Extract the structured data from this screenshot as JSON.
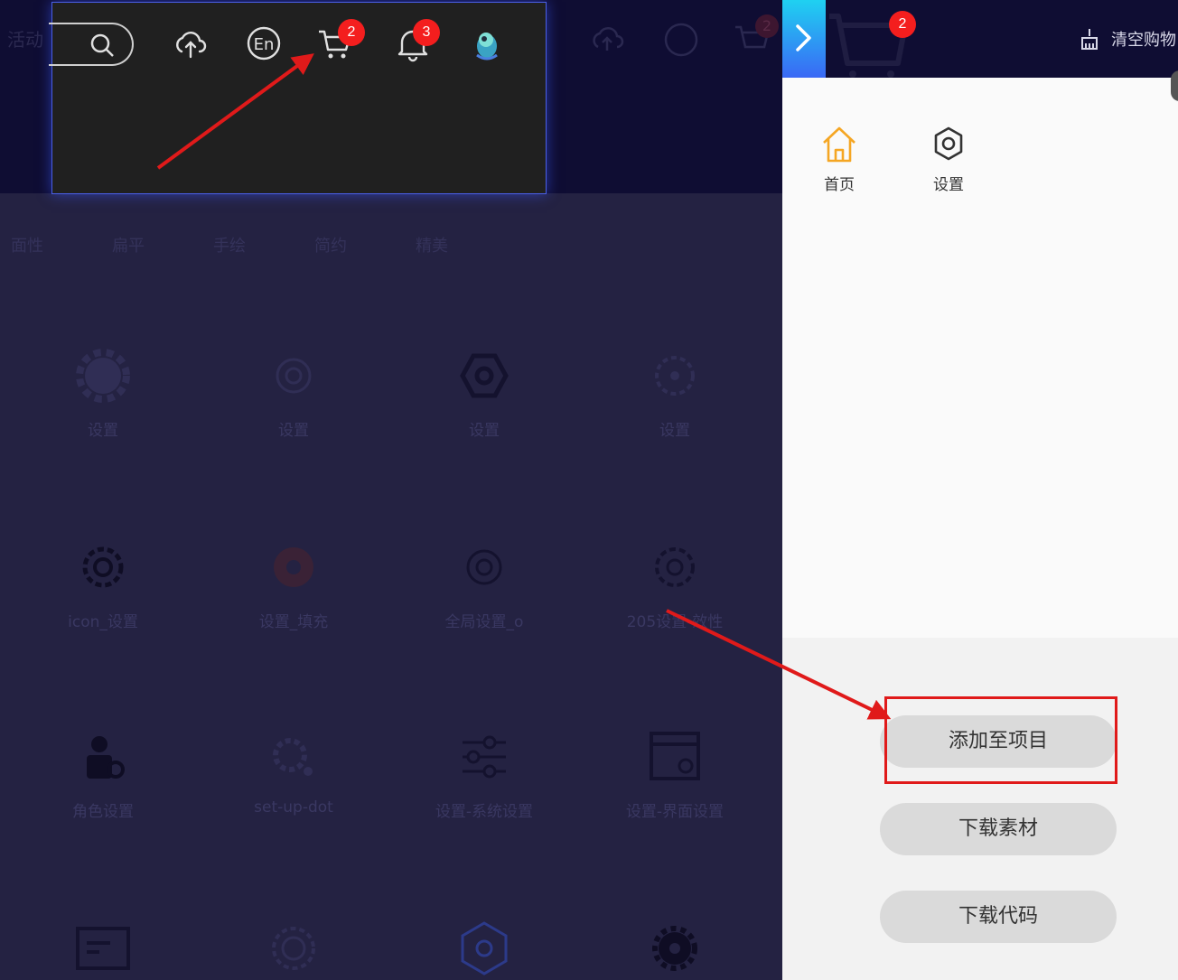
{
  "background_page": {
    "header_title": "活动",
    "cart_badge": "2",
    "tabs": [
      "面性",
      "扁平",
      "手绘",
      "简约",
      "精美"
    ],
    "grid": [
      {
        "label": "设置",
        "icon": "gear-filled-icon"
      },
      {
        "label": "设置",
        "icon": "gear-outline-icon"
      },
      {
        "label": "设置",
        "icon": "hex-nut-icon"
      },
      {
        "label": "设置",
        "icon": "gear-dotted-icon"
      },
      {
        "label": "icon_设置",
        "icon": "gear-outline-icon"
      },
      {
        "label": "设置_填充",
        "icon": "gear-filled-icon"
      },
      {
        "label": "全局设置_o",
        "icon": "gear-outline-icon"
      },
      {
        "label": "205设置-效性",
        "icon": "gear-outline-icon"
      },
      {
        "label": "角色设置",
        "icon": "role-settings-icon"
      },
      {
        "label": "set-up-dot",
        "icon": "gear-dot-icon"
      },
      {
        "label": "设置-系统设置",
        "icon": "sliders-icon"
      },
      {
        "label": "设置-界面设置",
        "icon": "window-settings-icon"
      },
      {
        "label": "",
        "icon": "card-icon"
      },
      {
        "label": "",
        "icon": "gear-outline-icon"
      },
      {
        "label": "",
        "icon": "gear-badge-icon"
      },
      {
        "label": "",
        "icon": "gear-filled-icon"
      }
    ]
  },
  "toolbar_popup": {
    "icons": [
      "search-icon",
      "cloud-upload-icon",
      "language-en-icon",
      "cart-icon",
      "bell-icon",
      "avatar"
    ],
    "cart_badge": "2",
    "bell_badge": "3"
  },
  "panel": {
    "cart_badge": "2",
    "clear_cart_label": "清空购物",
    "nav": [
      {
        "label": "首页",
        "icon": "home-icon",
        "color": "#f5a623"
      },
      {
        "label": "设置",
        "icon": "gear-icon",
        "color": "#333333"
      }
    ],
    "actions": {
      "add_to_project": "添加至项目",
      "download_asset": "下载素材",
      "download_code": "下载代码"
    }
  },
  "colors": {
    "annotation_red": "#e01a1a",
    "badge_red": "#f41e1e",
    "panel_bg": "#fafafa",
    "button_bg": "#dadada",
    "dark_header": "#0f0d33"
  }
}
